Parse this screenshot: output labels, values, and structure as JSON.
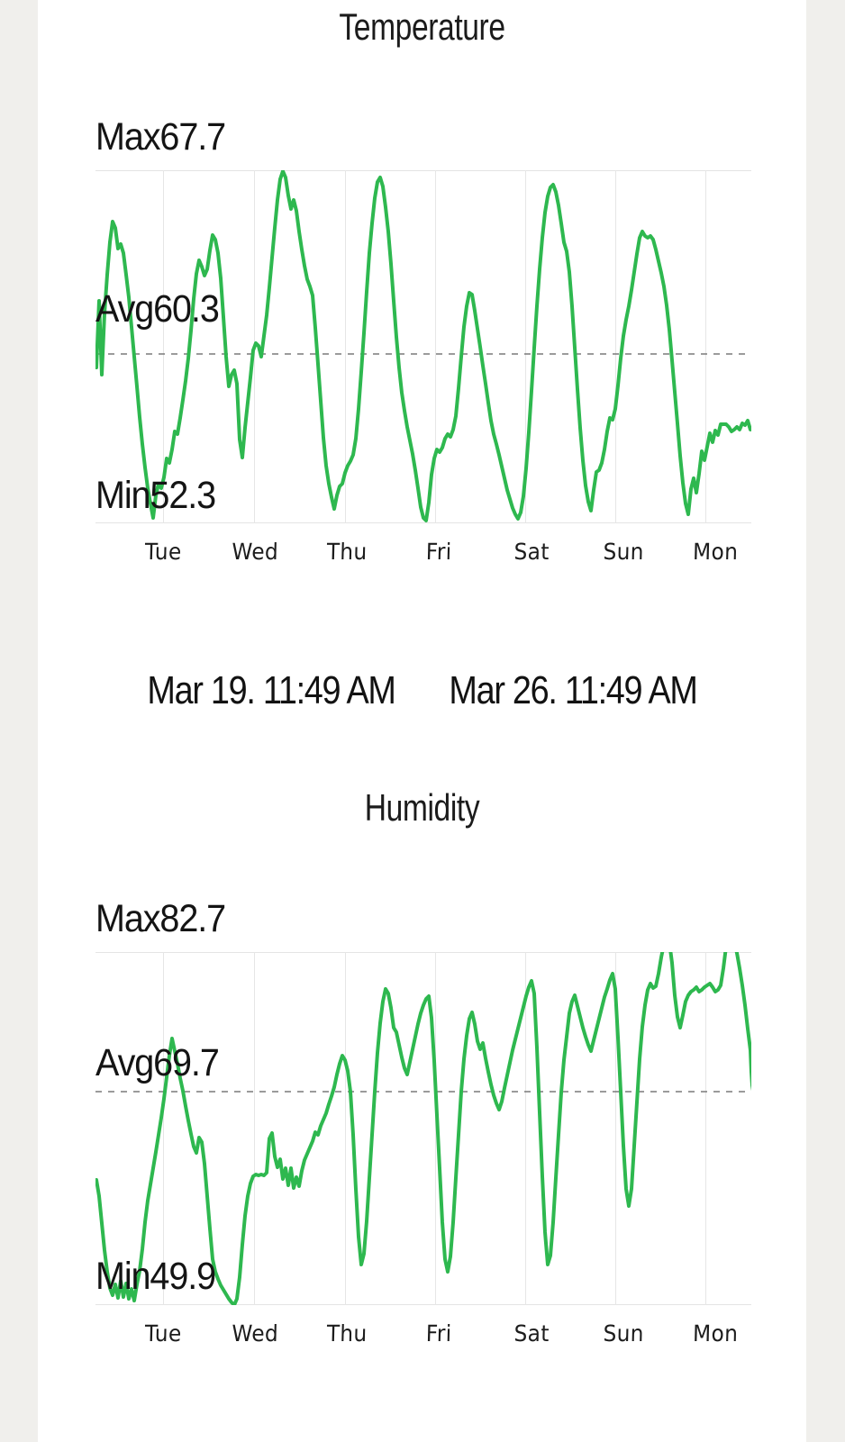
{
  "theme": {
    "page_background": "#f0efec",
    "card_background": "#ffffff",
    "line_color": "#2eb84f",
    "grid_color": "#e3e3e3",
    "axis_color": "#e0e0e0",
    "avg_line_color": "#6b6b6b",
    "text_color": "#141414"
  },
  "temperature": {
    "title": "Temperature",
    "max_label": "Max67.7",
    "avg_label": "Avg60.3",
    "min_label": "Min52.3",
    "days": [
      "Tue",
      "Wed",
      "Thu",
      "Fri",
      "Sat",
      "Sun",
      "Mon"
    ]
  },
  "date_range": {
    "start": "Mar 19. 11:49 AM",
    "end": "Mar 26. 11:49 AM"
  },
  "humidity": {
    "title": "Humidity",
    "max_label": "Max82.7",
    "avg_label": "Avg69.7",
    "min_label": "Min49.9",
    "days": [
      "Tue",
      "Wed",
      "Thu",
      "Fri",
      "Sat",
      "Sun",
      "Mon"
    ]
  },
  "chart_data": [
    {
      "type": "line",
      "title": "Temperature",
      "xlabel": "",
      "ylabel": "",
      "unit": "°F",
      "grid": true,
      "legend": "none",
      "max": 67.7,
      "avg": 60.3,
      "min": 52.3,
      "ylim": [
        52.3,
        67.7
      ],
      "categories": [
        "Tue",
        "Wed",
        "Thu",
        "Fri",
        "Sat",
        "Sun",
        "Mon"
      ],
      "annotations": [
        {
          "text": "Max67.7",
          "position": "above-plot-left"
        },
        {
          "text": "Avg60.3",
          "position": "avg-line-left"
        },
        {
          "text": "Min52.3",
          "position": "below-plot-left"
        }
      ],
      "avg_reference_line": 60.3,
      "x_start": "Mar 19. 11:49 AM",
      "x_end": "Mar 26. 11:49 AM",
      "values": [
        59.1,
        62.0,
        58.8,
        61.5,
        63.2,
        64.6,
        65.5,
        65.2,
        64.3,
        64.5,
        64.1,
        63.2,
        62.2,
        60.9,
        59.6,
        58.3,
        57.0,
        55.8,
        54.8,
        53.9,
        53.2,
        52.6,
        53.6,
        54.1,
        53.9,
        54.4,
        55.2,
        55.0,
        55.6,
        56.4,
        56.3,
        57.0,
        57.8,
        58.6,
        59.6,
        60.8,
        62.2,
        63.3,
        63.9,
        63.6,
        63.2,
        63.5,
        64.3,
        65.0,
        64.8,
        64.2,
        63.1,
        61.4,
        59.7,
        58.4,
        58.8,
        59.0,
        58.4,
        56.0,
        55.2,
        56.5,
        57.6,
        58.7,
        59.9,
        60.2,
        60.1,
        59.6,
        60.5,
        61.4,
        62.6,
        63.9,
        65.2,
        66.4,
        67.3,
        67.7,
        67.4,
        66.6,
        66.0,
        66.4,
        65.9,
        65.0,
        64.2,
        63.5,
        62.9,
        62.6,
        62.2,
        60.8,
        59.2,
        57.6,
        56.0,
        54.8,
        54.0,
        53.4,
        52.9,
        53.5,
        53.9,
        54.0,
        54.5,
        54.8,
        55.0,
        55.3,
        56.0,
        57.3,
        58.9,
        60.6,
        62.4,
        64.1,
        65.4,
        66.5,
        67.2,
        67.4,
        67.0,
        66.1,
        65.0,
        63.6,
        62.0,
        60.4,
        59.1,
        58.0,
        57.2,
        56.5,
        55.9,
        55.3,
        54.6,
        53.8,
        53.0,
        52.5,
        52.4,
        53.2,
        54.4,
        55.1,
        55.5,
        55.4,
        55.6,
        56.0,
        56.2,
        56.1,
        56.4,
        57.0,
        58.2,
        59.6,
        60.9,
        61.8,
        62.4,
        62.3,
        61.6,
        60.8,
        60.0,
        59.2,
        58.4,
        57.6,
        56.8,
        56.2,
        55.8,
        55.3,
        54.8,
        54.3,
        53.8,
        53.4,
        53.0,
        52.7,
        52.5,
        52.8,
        53.5,
        54.7,
        56.3,
        58.1,
        60.0,
        61.8,
        63.4,
        64.8,
        65.9,
        66.6,
        67.0,
        67.1,
        66.8,
        66.2,
        65.4,
        64.6,
        64.2,
        63.3,
        61.8,
        60.0,
        58.2,
        56.5,
        55.1,
        54.0,
        53.3,
        52.9,
        53.8,
        54.6,
        54.7,
        55.0,
        55.6,
        56.4,
        57.0,
        56.9,
        57.4,
        58.4,
        59.6,
        60.6,
        61.3,
        61.9,
        62.6,
        63.4,
        64.2,
        64.9,
        65.2,
        65.0,
        64.9,
        65.0,
        64.8,
        64.4,
        63.9,
        63.4,
        62.8,
        62.0,
        60.9,
        59.6,
        58.2,
        56.8,
        55.4,
        54.2,
        53.3,
        52.8,
        53.9,
        54.4,
        53.8,
        54.6,
        55.6,
        55.2,
        55.8,
        56.4,
        56.0,
        56.5,
        56.3,
        56.8
      ]
    },
    {
      "type": "line",
      "title": "Humidity",
      "xlabel": "",
      "ylabel": "",
      "unit": "%",
      "grid": true,
      "legend": "none",
      "max": 82.7,
      "avg": 69.7,
      "min": 49.9,
      "ylim": [
        49.9,
        82.7
      ],
      "categories": [
        "Tue",
        "Wed",
        "Thu",
        "Fri",
        "Sat",
        "Sun",
        "Mon"
      ],
      "annotations": [
        {
          "text": "Max82.7",
          "position": "above-plot-left"
        },
        {
          "text": "Avg69.7",
          "position": "avg-line-left"
        },
        {
          "text": "Min49.9",
          "position": "below-plot-left"
        }
      ],
      "avg_reference_line": 69.7,
      "x_start": "Mar 19. 11:49 AM",
      "x_end": "Mar 26. 11:49 AM",
      "values": [
        61.5,
        60.0,
        57.5,
        55.0,
        53.0,
        51.5,
        50.8,
        51.8,
        50.6,
        52.2,
        50.7,
        51.9,
        50.5,
        51.4,
        50.3,
        51.8,
        53.0,
        55.0,
        57.5,
        59.5,
        61.0,
        62.5,
        64.0,
        65.6,
        67.2,
        69.0,
        71.0,
        73.0,
        74.6,
        73.5,
        72.3,
        71.0,
        69.8,
        68.4,
        67.0,
        65.8,
        64.6,
        64.0,
        65.4,
        65.0,
        63.0,
        60.0,
        57.0,
        54.2,
        53.0,
        52.4,
        51.8,
        51.4,
        51.0,
        50.6,
        50.2,
        49.9,
        50.5,
        52.5,
        55.5,
        58.2,
        60.0,
        61.2,
        62.0,
        62.2,
        62.1,
        62.2,
        62.1,
        62.3,
        65.5,
        66.0,
        63.8,
        62.8,
        63.6,
        61.8,
        62.8,
        61.2,
        62.8,
        61.0,
        62.0,
        61.2,
        62.6,
        63.6,
        64.2,
        64.8,
        65.4,
        66.2,
        66.0,
        66.8,
        67.4,
        68.0,
        68.8,
        69.6,
        70.4,
        71.6,
        72.6,
        73.4,
        73.0,
        72.0,
        70.0,
        66.0,
        61.0,
        56.6,
        54.0,
        55.0,
        58.0,
        62.0,
        66.0,
        70.0,
        73.6,
        76.4,
        78.4,
        79.6,
        79.2,
        77.8,
        76.0,
        75.6,
        74.4,
        73.2,
        72.2,
        71.6,
        72.8,
        74.0,
        75.2,
        76.4,
        77.4,
        78.2,
        78.8,
        79.0,
        77.0,
        73.0,
        68.0,
        63.0,
        58.0,
        54.6,
        53.4,
        54.8,
        58.0,
        62.0,
        66.0,
        70.0,
        73.0,
        75.2,
        76.8,
        77.4,
        76.2,
        74.6,
        73.8,
        74.4,
        73.0,
        71.8,
        70.6,
        69.6,
        68.8,
        68.2,
        69.0,
        70.2,
        71.4,
        72.6,
        73.8,
        74.8,
        75.8,
        76.8,
        77.8,
        78.8,
        79.6,
        80.2,
        79.0,
        74.0,
        68.0,
        62.0,
        56.8,
        53.8,
        54.6,
        58.0,
        62.0,
        66.0,
        69.8,
        72.8,
        75.0,
        76.2,
        76.8,
        77.0,
        76.0,
        75.0,
        74.0,
        73.2,
        72.4,
        71.8,
        72.8,
        73.8,
        74.8,
        75.8,
        76.8,
        77.6,
        78.4,
        79.0,
        77.6,
        73.0,
        68.0,
        63.0,
        59.0,
        57.4,
        59.0,
        63.0,
        67.0,
        71.0,
        74.0,
        76.0,
        77.4,
        78.0,
        77.6,
        77.8,
        79.0,
        80.5,
        81.8,
        82.7,
        82.0,
        80.0,
        77.0,
        75.0,
        74.0,
        75.2,
        76.4,
        77.0,
        77.4,
        77.6,
        77.8,
        77.4,
        77.6,
        77.8,
        78.0,
        78.2,
        77.8,
        77.4,
        77.6,
        78.0,
        79.6,
        81.6,
        82.6,
        82.4,
        82.0,
        81.0,
        79.6,
        78.0,
        76.2,
        74.0,
        72.0,
        70.4,
        69.6,
        69.4,
        69.3,
        69.2,
        68.0,
        65.0,
        62.0,
        59.5
      ]
    }
  ]
}
